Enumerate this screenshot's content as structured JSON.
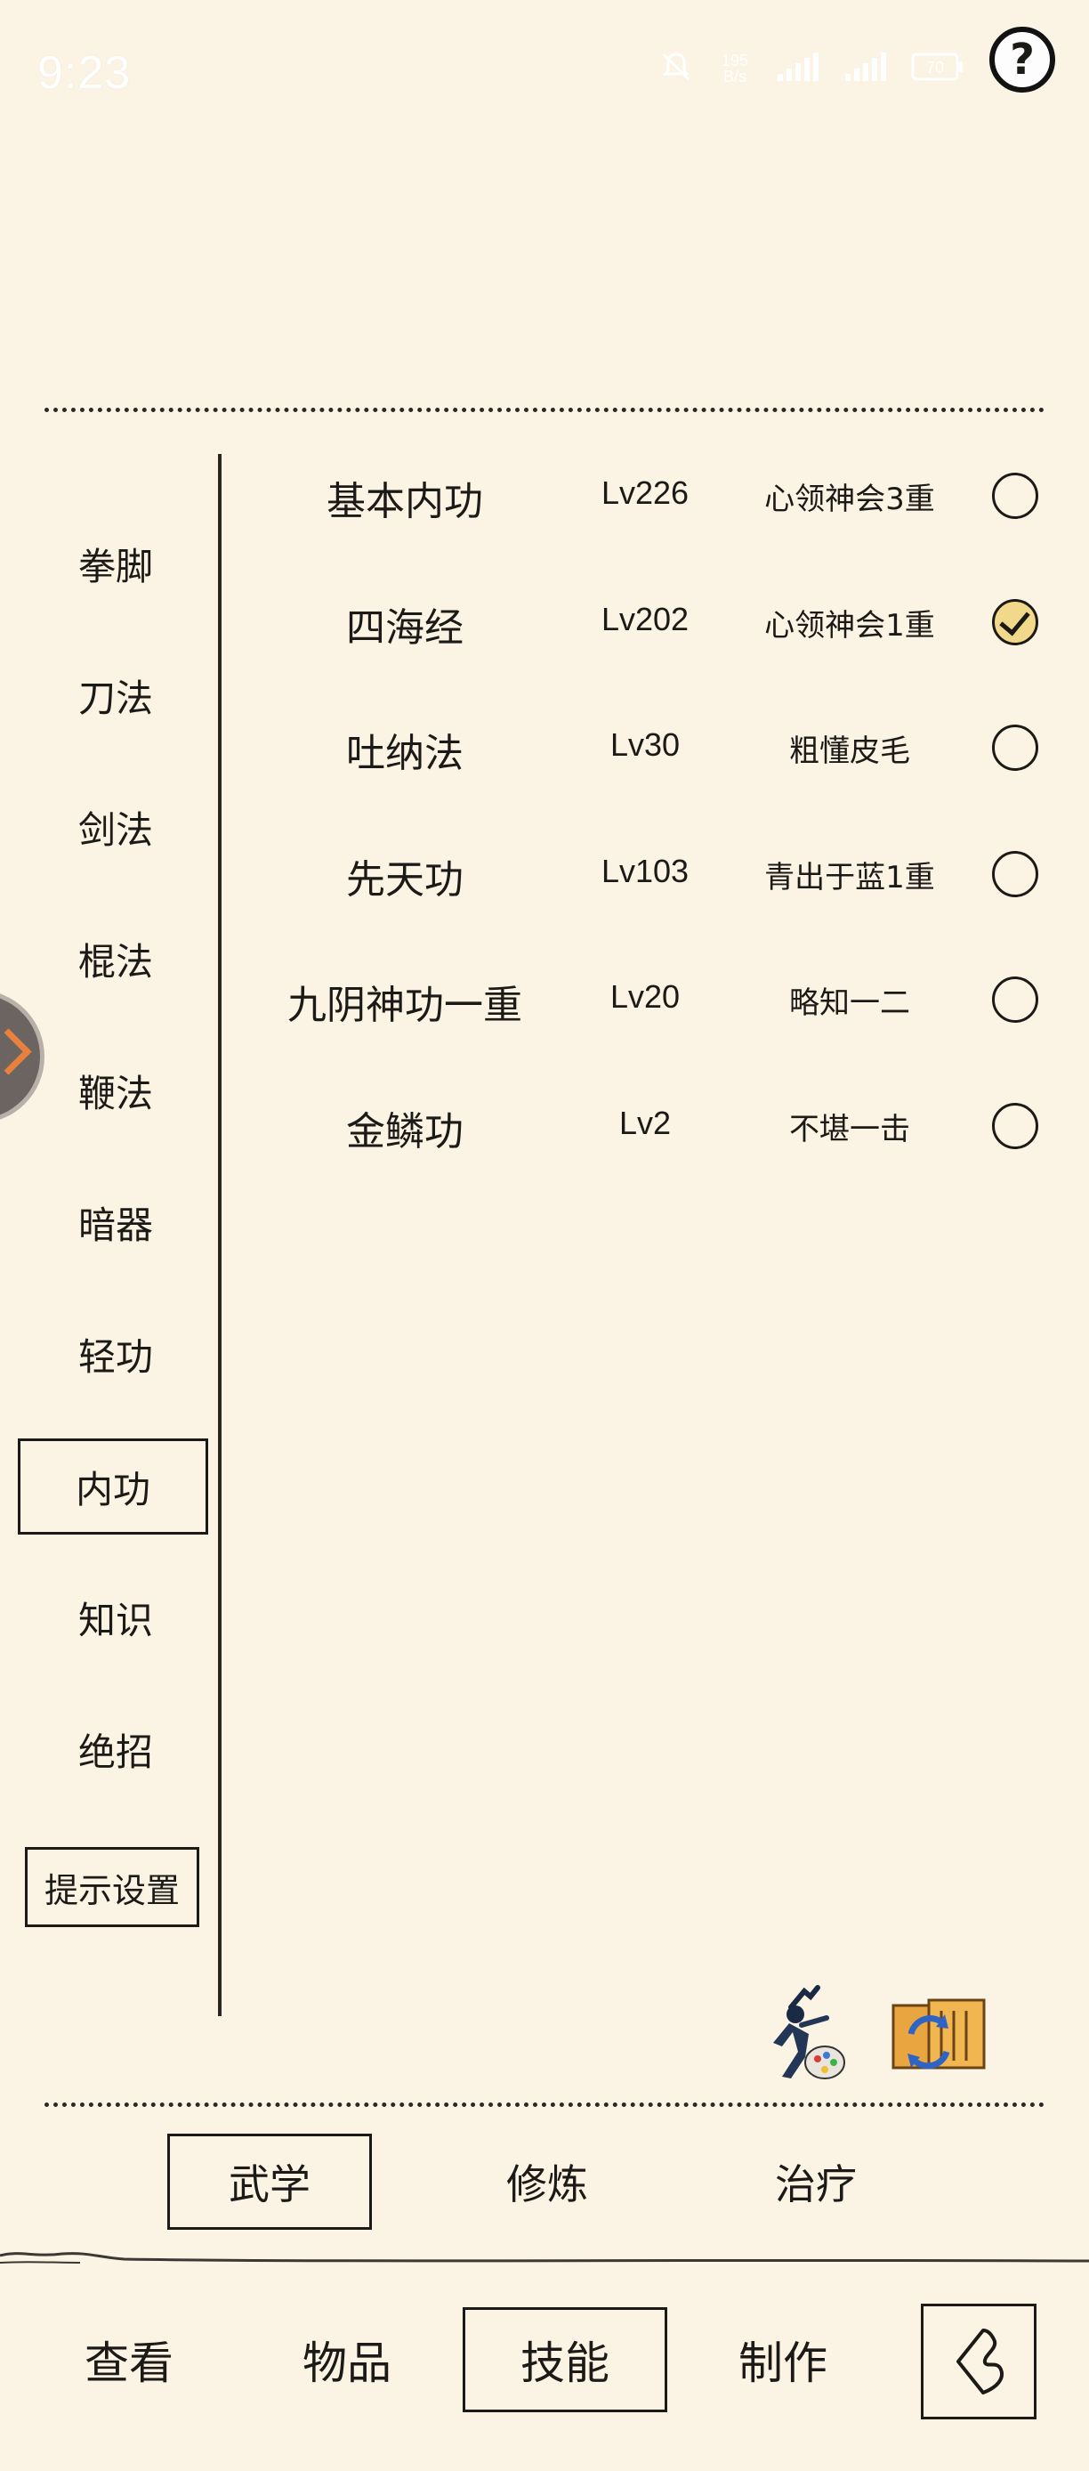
{
  "status_bar": {
    "time": "9:23",
    "speed_value": "195",
    "speed_unit": "B/s",
    "battery_level": "70"
  },
  "help_label": "?",
  "categories": [
    {
      "label": "拳脚"
    },
    {
      "label": "刀法"
    },
    {
      "label": "剑法"
    },
    {
      "label": "棍法"
    },
    {
      "label": "鞭法"
    },
    {
      "label": "暗器"
    },
    {
      "label": "轻功"
    },
    {
      "label": "内功",
      "selected": true
    },
    {
      "label": "知识"
    },
    {
      "label": "绝招"
    }
  ],
  "tip_settings_label": "提示设置",
  "skills": [
    {
      "name": "基本内功",
      "level": "Lv226",
      "rank": "心领神会3重",
      "checked": false
    },
    {
      "name": "四海经",
      "level": "Lv202",
      "rank": "心领神会1重",
      "checked": true
    },
    {
      "name": "吐纳法",
      "level": "Lv30",
      "rank": "粗懂皮毛",
      "checked": false
    },
    {
      "name": "先天功",
      "level": "Lv103",
      "rank": "青出于蓝1重",
      "checked": false
    },
    {
      "name": "九阴神功一重",
      "level": "Lv20",
      "rank": "略知一二",
      "checked": false
    },
    {
      "name": "金鳞功",
      "level": "Lv2",
      "rank": "不堪一击",
      "checked": false
    }
  ],
  "sub_tabs": [
    {
      "label": "武学",
      "active": true
    },
    {
      "label": "修炼",
      "active": false
    },
    {
      "label": "治疗",
      "active": false
    }
  ],
  "bottom_nav": [
    {
      "label": "查看",
      "active": false
    },
    {
      "label": "物品",
      "active": false
    },
    {
      "label": "技能",
      "active": true
    },
    {
      "label": "制作",
      "active": false
    }
  ],
  "colors": {
    "background": "#fbf3e3",
    "ink": "#1c1a17",
    "check_fill": "#f2d88a"
  },
  "icons": [
    "help-icon",
    "ninja-painter-icon",
    "scroll-refresh-icon",
    "back-arrow-icon",
    "floating-button-icon"
  ]
}
